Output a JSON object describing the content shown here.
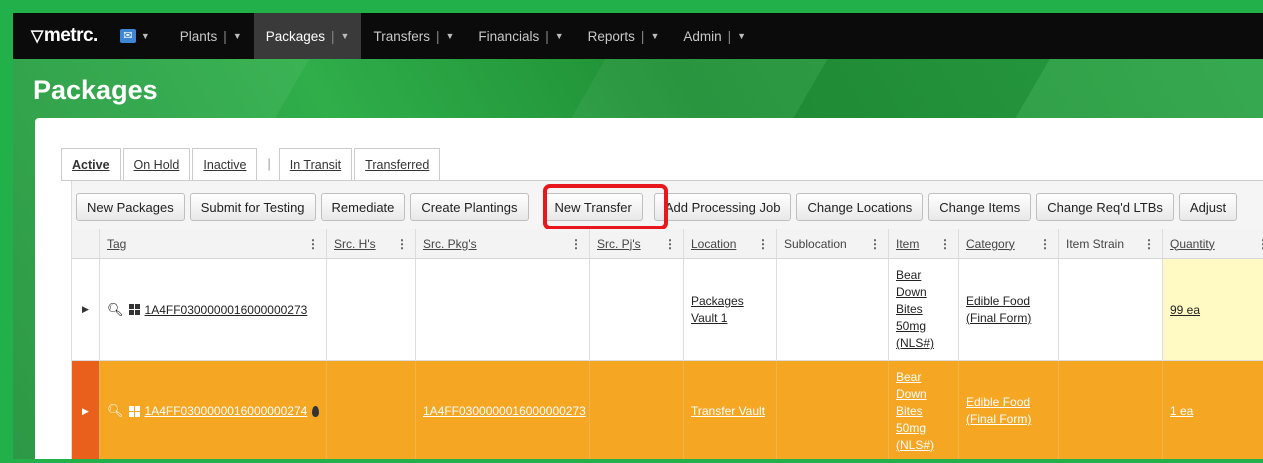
{
  "nav": {
    "logo": "metrc.",
    "items": [
      {
        "label": "Plants",
        "active": false
      },
      {
        "label": "Packages",
        "active": true
      },
      {
        "label": "Transfers",
        "active": false
      },
      {
        "label": "Financials",
        "active": false
      },
      {
        "label": "Reports",
        "active": false
      },
      {
        "label": "Admin",
        "active": false
      }
    ]
  },
  "page": {
    "title": "Packages"
  },
  "tabs": [
    "Active",
    "On Hold",
    "Inactive",
    "In Transit",
    "Transferred"
  ],
  "toolbar": [
    "New Packages",
    "Submit for Testing",
    "Remediate",
    "Create Plantings",
    "New Transfer",
    "Add Processing Job",
    "Change Locations",
    "Change Items",
    "Change Req'd LTBs",
    "Adjust"
  ],
  "columns": [
    "Tag",
    "Src. H's",
    "Src. Pkg's",
    "Src. Pj's",
    "Location",
    "Sublocation",
    "Item",
    "Category",
    "Item Strain",
    "Quantity"
  ],
  "rows": [
    {
      "tag": "1A4FF0300000016000000273",
      "src_pkg": "",
      "location_l1": "Packages",
      "location_l2": "Vault 1",
      "item": [
        "Bear",
        "Down",
        "Bites",
        "50mg",
        "(NLS#)"
      ],
      "category_l1": "Edible Food",
      "category_l2": "(Final Form)",
      "quantity": "99 ea"
    },
    {
      "tag": "1A4FF0300000016000000274",
      "src_pkg": "1A4FF0300000016000000273",
      "location_l1": "Transfer Vault",
      "item": [
        "Bear",
        "Down",
        "Bites",
        "50mg",
        "(NLS#)"
      ],
      "category_l1": "Edible Food",
      "category_l2": "(Final Form)",
      "quantity": "1 ea"
    }
  ],
  "colors": {
    "accent_row": "#f5a623",
    "highlight": "#e8171e",
    "nav_bg": "#0b0b0b"
  }
}
